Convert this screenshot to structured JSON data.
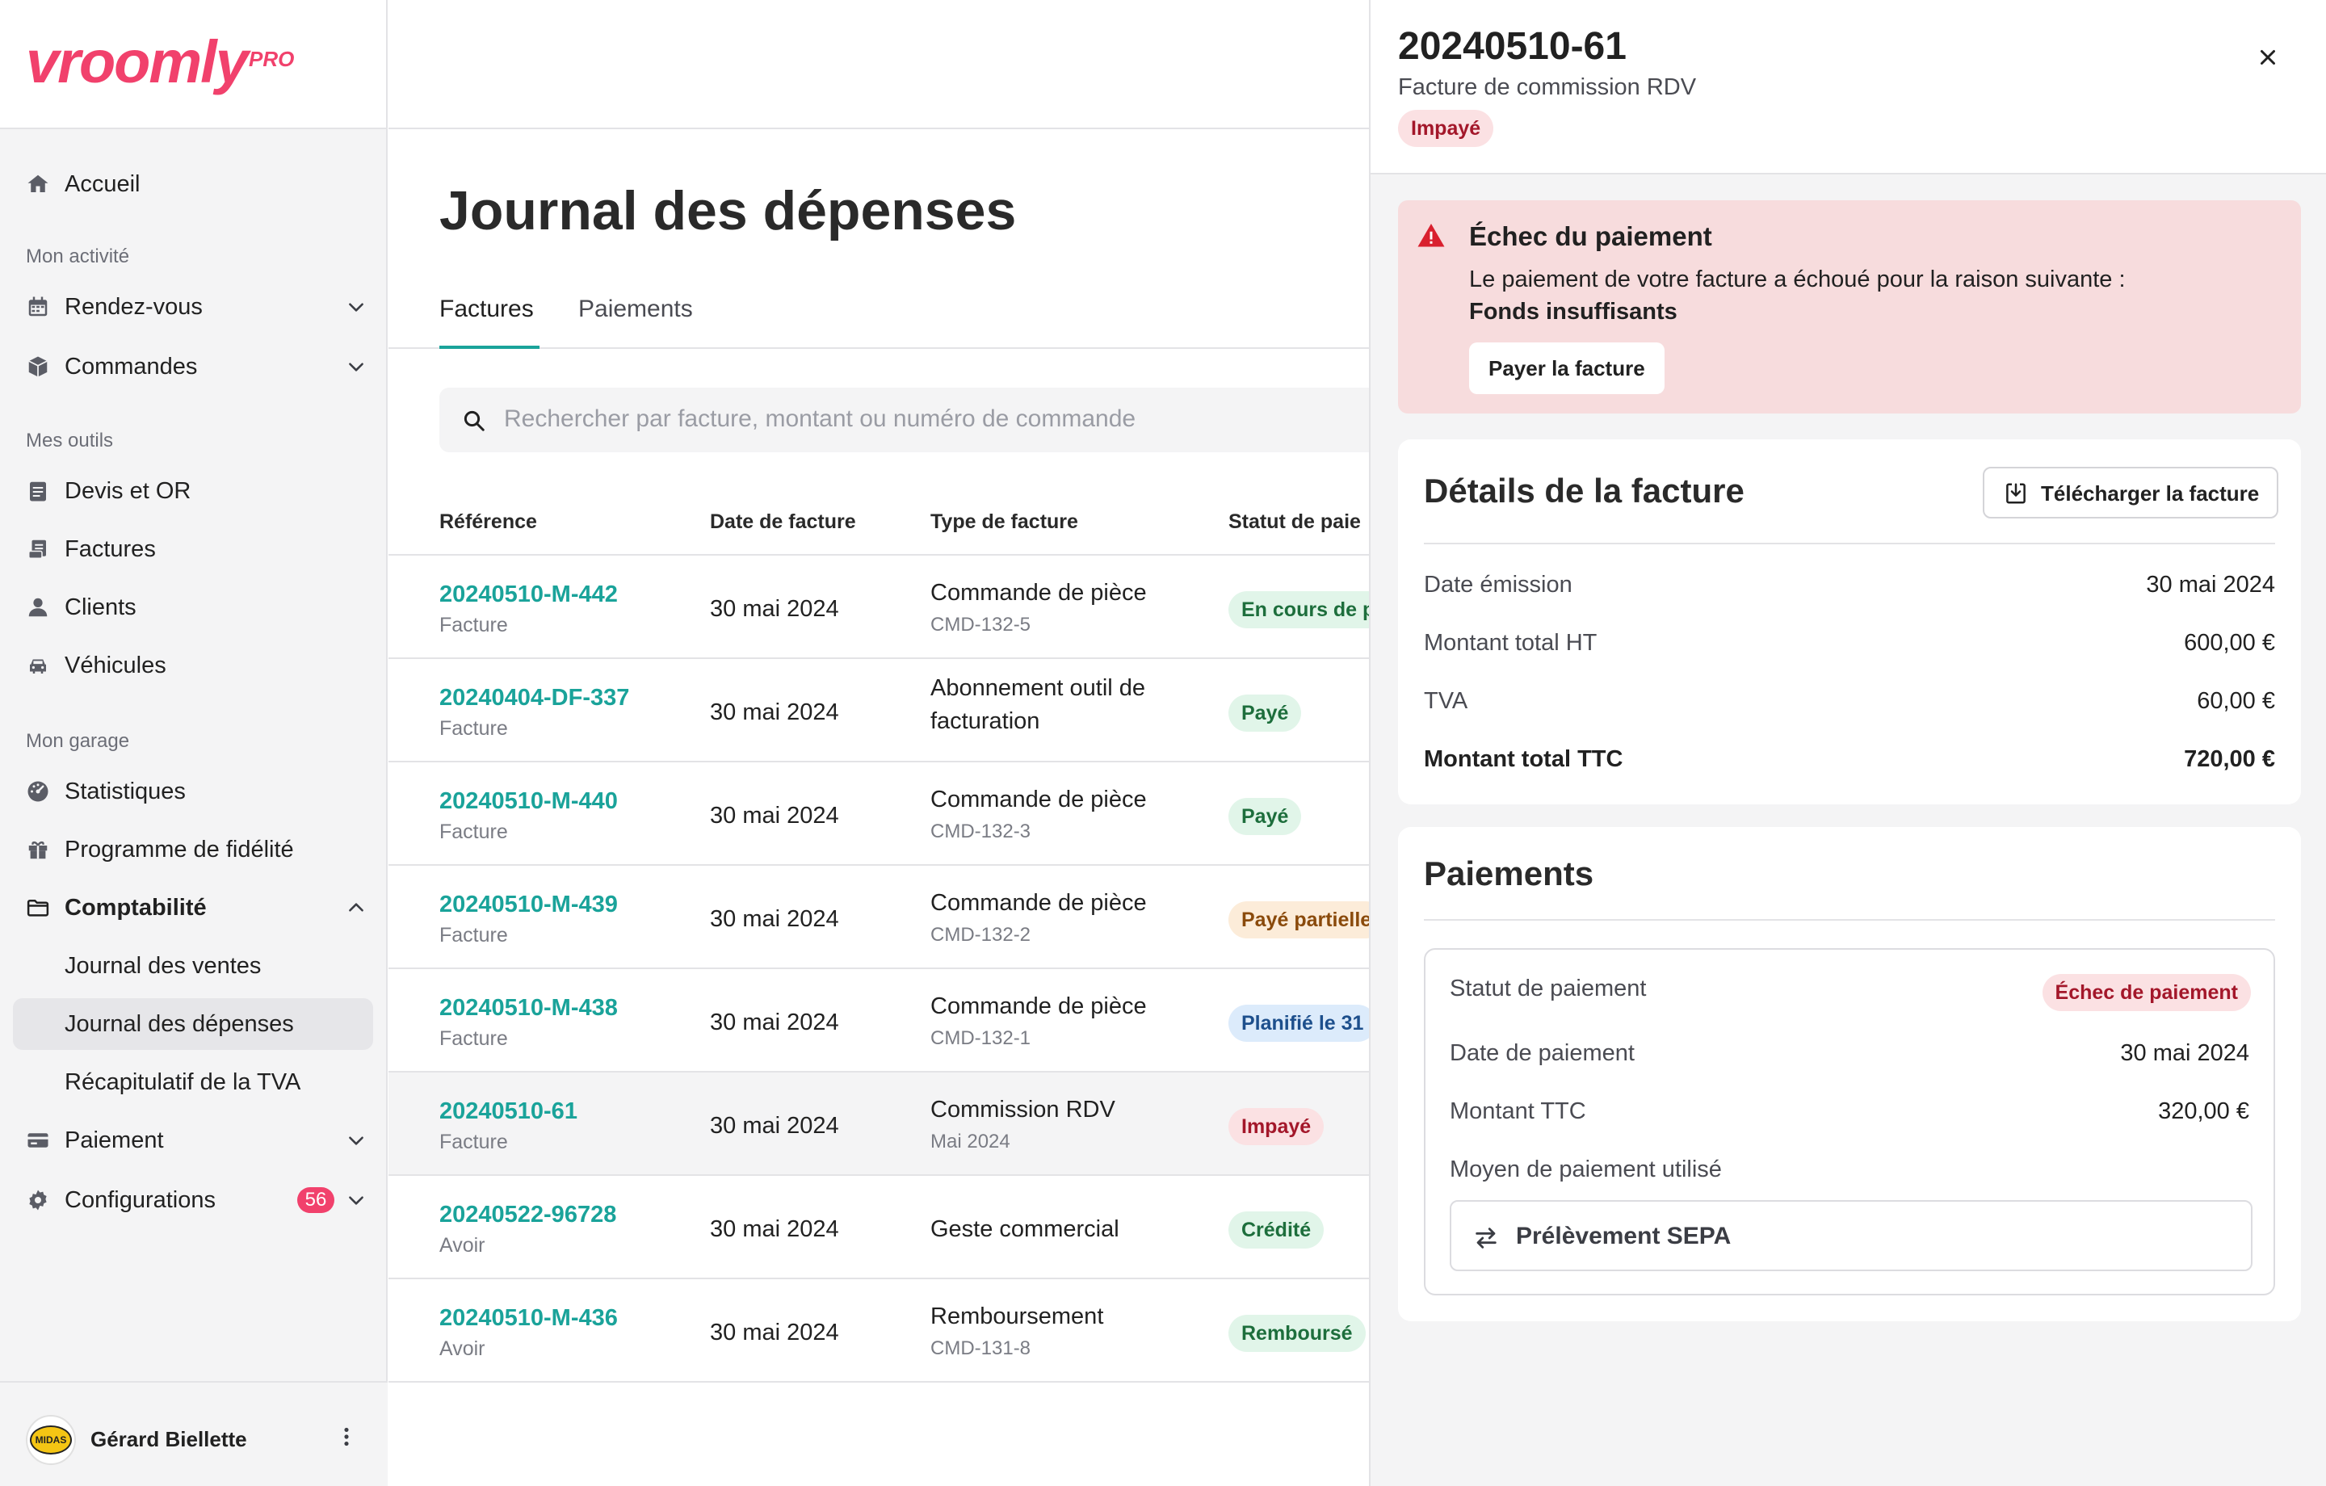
{
  "brand": {
    "name": "vroomly",
    "suffix": "PRO"
  },
  "sidebar": {
    "home": "Accueil",
    "sections": {
      "activity": "Mon activité",
      "tools": "Mes outils",
      "garage": "Mon garage"
    },
    "activity_items": [
      "Rendez-vous",
      "Commandes"
    ],
    "tool_items": [
      "Devis et OR",
      "Factures",
      "Clients",
      "Véhicules"
    ],
    "garage_items": {
      "stats": "Statistiques",
      "loyalty": "Programme de fidélité",
      "accounting": "Comptabilité",
      "accounting_sub": [
        "Journal des ventes",
        "Journal des dépenses",
        "Récapitulatif de la TVA"
      ],
      "payment": "Paiement",
      "config": "Configurations",
      "config_badge": "56"
    },
    "user": {
      "name": "Gérard Biellette",
      "avatar_text": "MIDAS"
    }
  },
  "main": {
    "title": "Journal des dépenses",
    "tabs": [
      "Factures",
      "Paiements"
    ],
    "search_placeholder": "Rechercher par facture, montant ou numéro de commande",
    "columns": [
      "Référence",
      "Date de facture",
      "Type de facture",
      "Statut de paie"
    ],
    "rows": [
      {
        "ref": "20240510-M-442",
        "kind": "Facture",
        "date": "30 mai 2024",
        "type": "Commande de pièce",
        "sub": "CMD-132-5",
        "status": "En cours de p",
        "status_color": "green"
      },
      {
        "ref": "20240404-DF-337",
        "kind": "Facture",
        "date": "30 mai 2024",
        "type": "Abonnement outil de facturation",
        "sub": "",
        "status": "Payé",
        "status_color": "green"
      },
      {
        "ref": "20240510-M-440",
        "kind": "Facture",
        "date": "30 mai 2024",
        "type": "Commande de pièce",
        "sub": "CMD-132-3",
        "status": "Payé",
        "status_color": "green"
      },
      {
        "ref": "20240510-M-439",
        "kind": "Facture",
        "date": "30 mai 2024",
        "type": "Commande de pièce",
        "sub": "CMD-132-2",
        "status": "Payé partielle",
        "status_color": "orange"
      },
      {
        "ref": "20240510-M-438",
        "kind": "Facture",
        "date": "30 mai 2024",
        "type": "Commande de pièce",
        "sub": "CMD-132-1",
        "status": "Planifié le 31",
        "status_color": "blue"
      },
      {
        "ref": "20240510-61",
        "kind": "Facture",
        "date": "30 mai 2024",
        "type": "Commission RDV",
        "sub": "Mai 2024",
        "status": "Impayé",
        "status_color": "red"
      },
      {
        "ref": "20240522-96728",
        "kind": "Avoir",
        "date": "30 mai 2024",
        "type": "Geste commercial",
        "sub": "",
        "status": "Crédité",
        "status_color": "green"
      },
      {
        "ref": "20240510-M-436",
        "kind": "Avoir",
        "date": "30 mai 2024",
        "type": "Remboursement",
        "sub": "CMD-131-8",
        "status": "Remboursé",
        "status_color": "green"
      }
    ]
  },
  "drawer": {
    "title": "20240510-61",
    "subtitle": "Facture de commission RDV",
    "status": "Impayé",
    "alert": {
      "title": "Échec du paiement",
      "message": "Le paiement de votre facture a échoué pour la raison suivante :",
      "reason": "Fonds insuffisants",
      "button": "Payer la facture"
    },
    "details": {
      "title": "Détails de la facture",
      "download": "Télécharger la facture",
      "rows": [
        {
          "label": "Date émission",
          "value": "30 mai 2024"
        },
        {
          "label": "Montant total HT",
          "value": "600,00 €"
        },
        {
          "label": "TVA",
          "value": "60,00 €"
        },
        {
          "label": "Montant total TTC",
          "value": "720,00 €"
        }
      ]
    },
    "payments": {
      "title": "Paiements",
      "status_label": "Statut de paiement",
      "status_value": "Échec de paiement",
      "date_label": "Date de paiement",
      "date_value": "30 mai 2024",
      "amount_label": "Montant TTC",
      "amount_value": "320,00 €",
      "method_label": "Moyen de paiement utilisé",
      "method_value": "Prélèvement SEPA"
    }
  },
  "colors": {
    "brand": "#f1416c",
    "link": "#1aa39a",
    "danger": "#d9202e"
  }
}
